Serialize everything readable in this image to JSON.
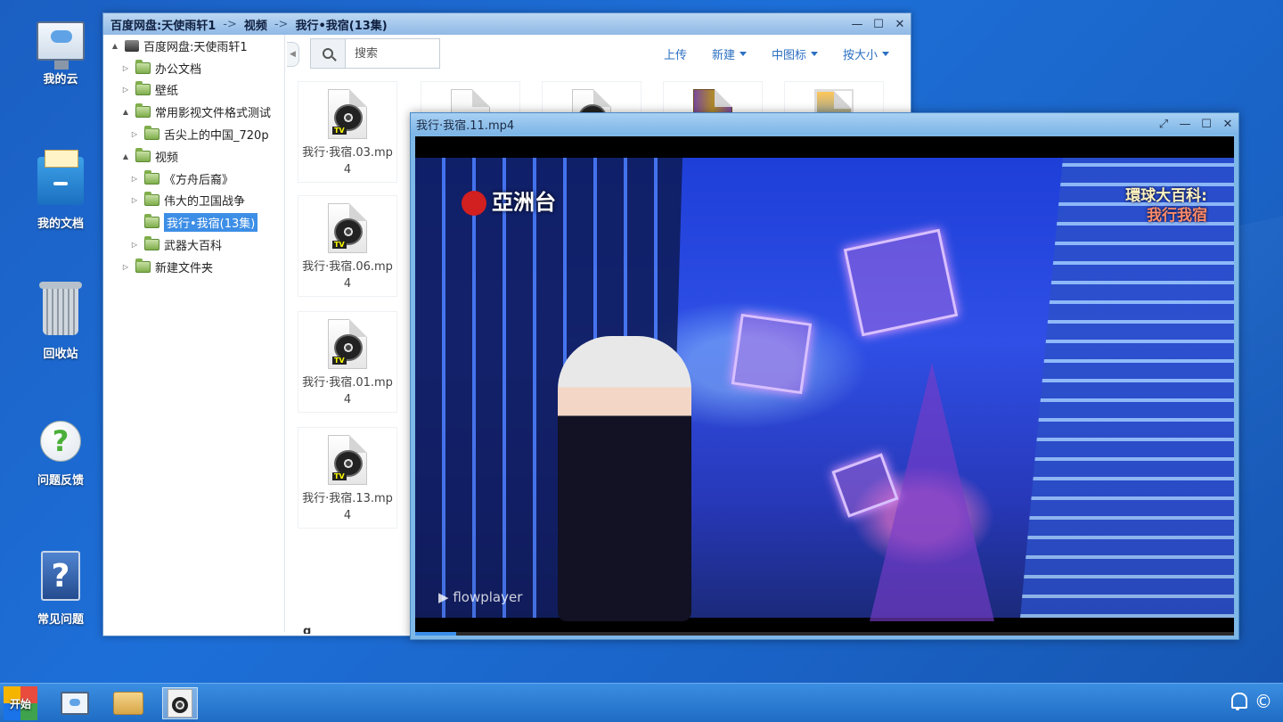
{
  "desktop": {
    "icons": [
      {
        "label": "我的云",
        "icon": "cloud-monitor-icon"
      },
      {
        "label": "我的文档",
        "icon": "documents-drawer-icon"
      },
      {
        "label": "回收站",
        "icon": "recycle-bin-icon"
      },
      {
        "label": "问题反馈",
        "icon": "feedback-help-icon"
      },
      {
        "label": "常见问题",
        "icon": "faq-icon"
      }
    ]
  },
  "explorer": {
    "breadcrumb": [
      "百度网盘:天使雨轩1",
      "视频",
      "我行•我宿(13集)"
    ],
    "separator": "->",
    "tree": [
      {
        "label": "百度网盘:天使雨轩1",
        "arrow": "▲",
        "type": "drive"
      },
      {
        "label": "办公文档",
        "arrow": "▷",
        "type": "folder"
      },
      {
        "label": "壁纸",
        "arrow": "▷",
        "type": "folder"
      },
      {
        "label": "常用影视文件格式测试",
        "arrow": "▲",
        "type": "folder"
      },
      {
        "label": "舌尖上的中国_720p",
        "arrow": "▷",
        "type": "folder"
      },
      {
        "label": "视频",
        "arrow": "▲",
        "type": "folder"
      },
      {
        "label": "《方舟后裔》",
        "arrow": "▷",
        "type": "folder"
      },
      {
        "label": "伟大的卫国战争",
        "arrow": "▷",
        "type": "folder"
      },
      {
        "label": "我行•我宿(13集)",
        "arrow": "",
        "type": "folder"
      },
      {
        "label": "武器大百科",
        "arrow": "▷",
        "type": "folder"
      },
      {
        "label": "新建文件夹",
        "arrow": "▷",
        "type": "folder"
      }
    ],
    "search": {
      "placeholder": "搜索"
    },
    "toolbar": {
      "upload": "上传",
      "new": "新建",
      "view": "中图标",
      "sort": "按大小"
    },
    "files": [
      {
        "name": "我行·我宿.03.mp4"
      },
      {
        "name": "我行·我宿.06.mp4"
      },
      {
        "name": "我行·我宿.01.mp4"
      },
      {
        "name": "我行·我宿.13.mp4"
      }
    ],
    "partial_label": "g"
  },
  "player": {
    "title": "我行·我宿.11.mp4",
    "overlay": {
      "channel": "亞洲台",
      "program_line1": "環球大百科:",
      "program_line2": "我行我宿",
      "watermark": "flowplayer"
    },
    "progress": 0.05
  },
  "taskbar": {
    "start_label": "开始",
    "tray_copyright": "©"
  },
  "controls": {
    "minimize": "—",
    "maximize": "☐",
    "close": "✕",
    "fullscreen": "⤢"
  }
}
